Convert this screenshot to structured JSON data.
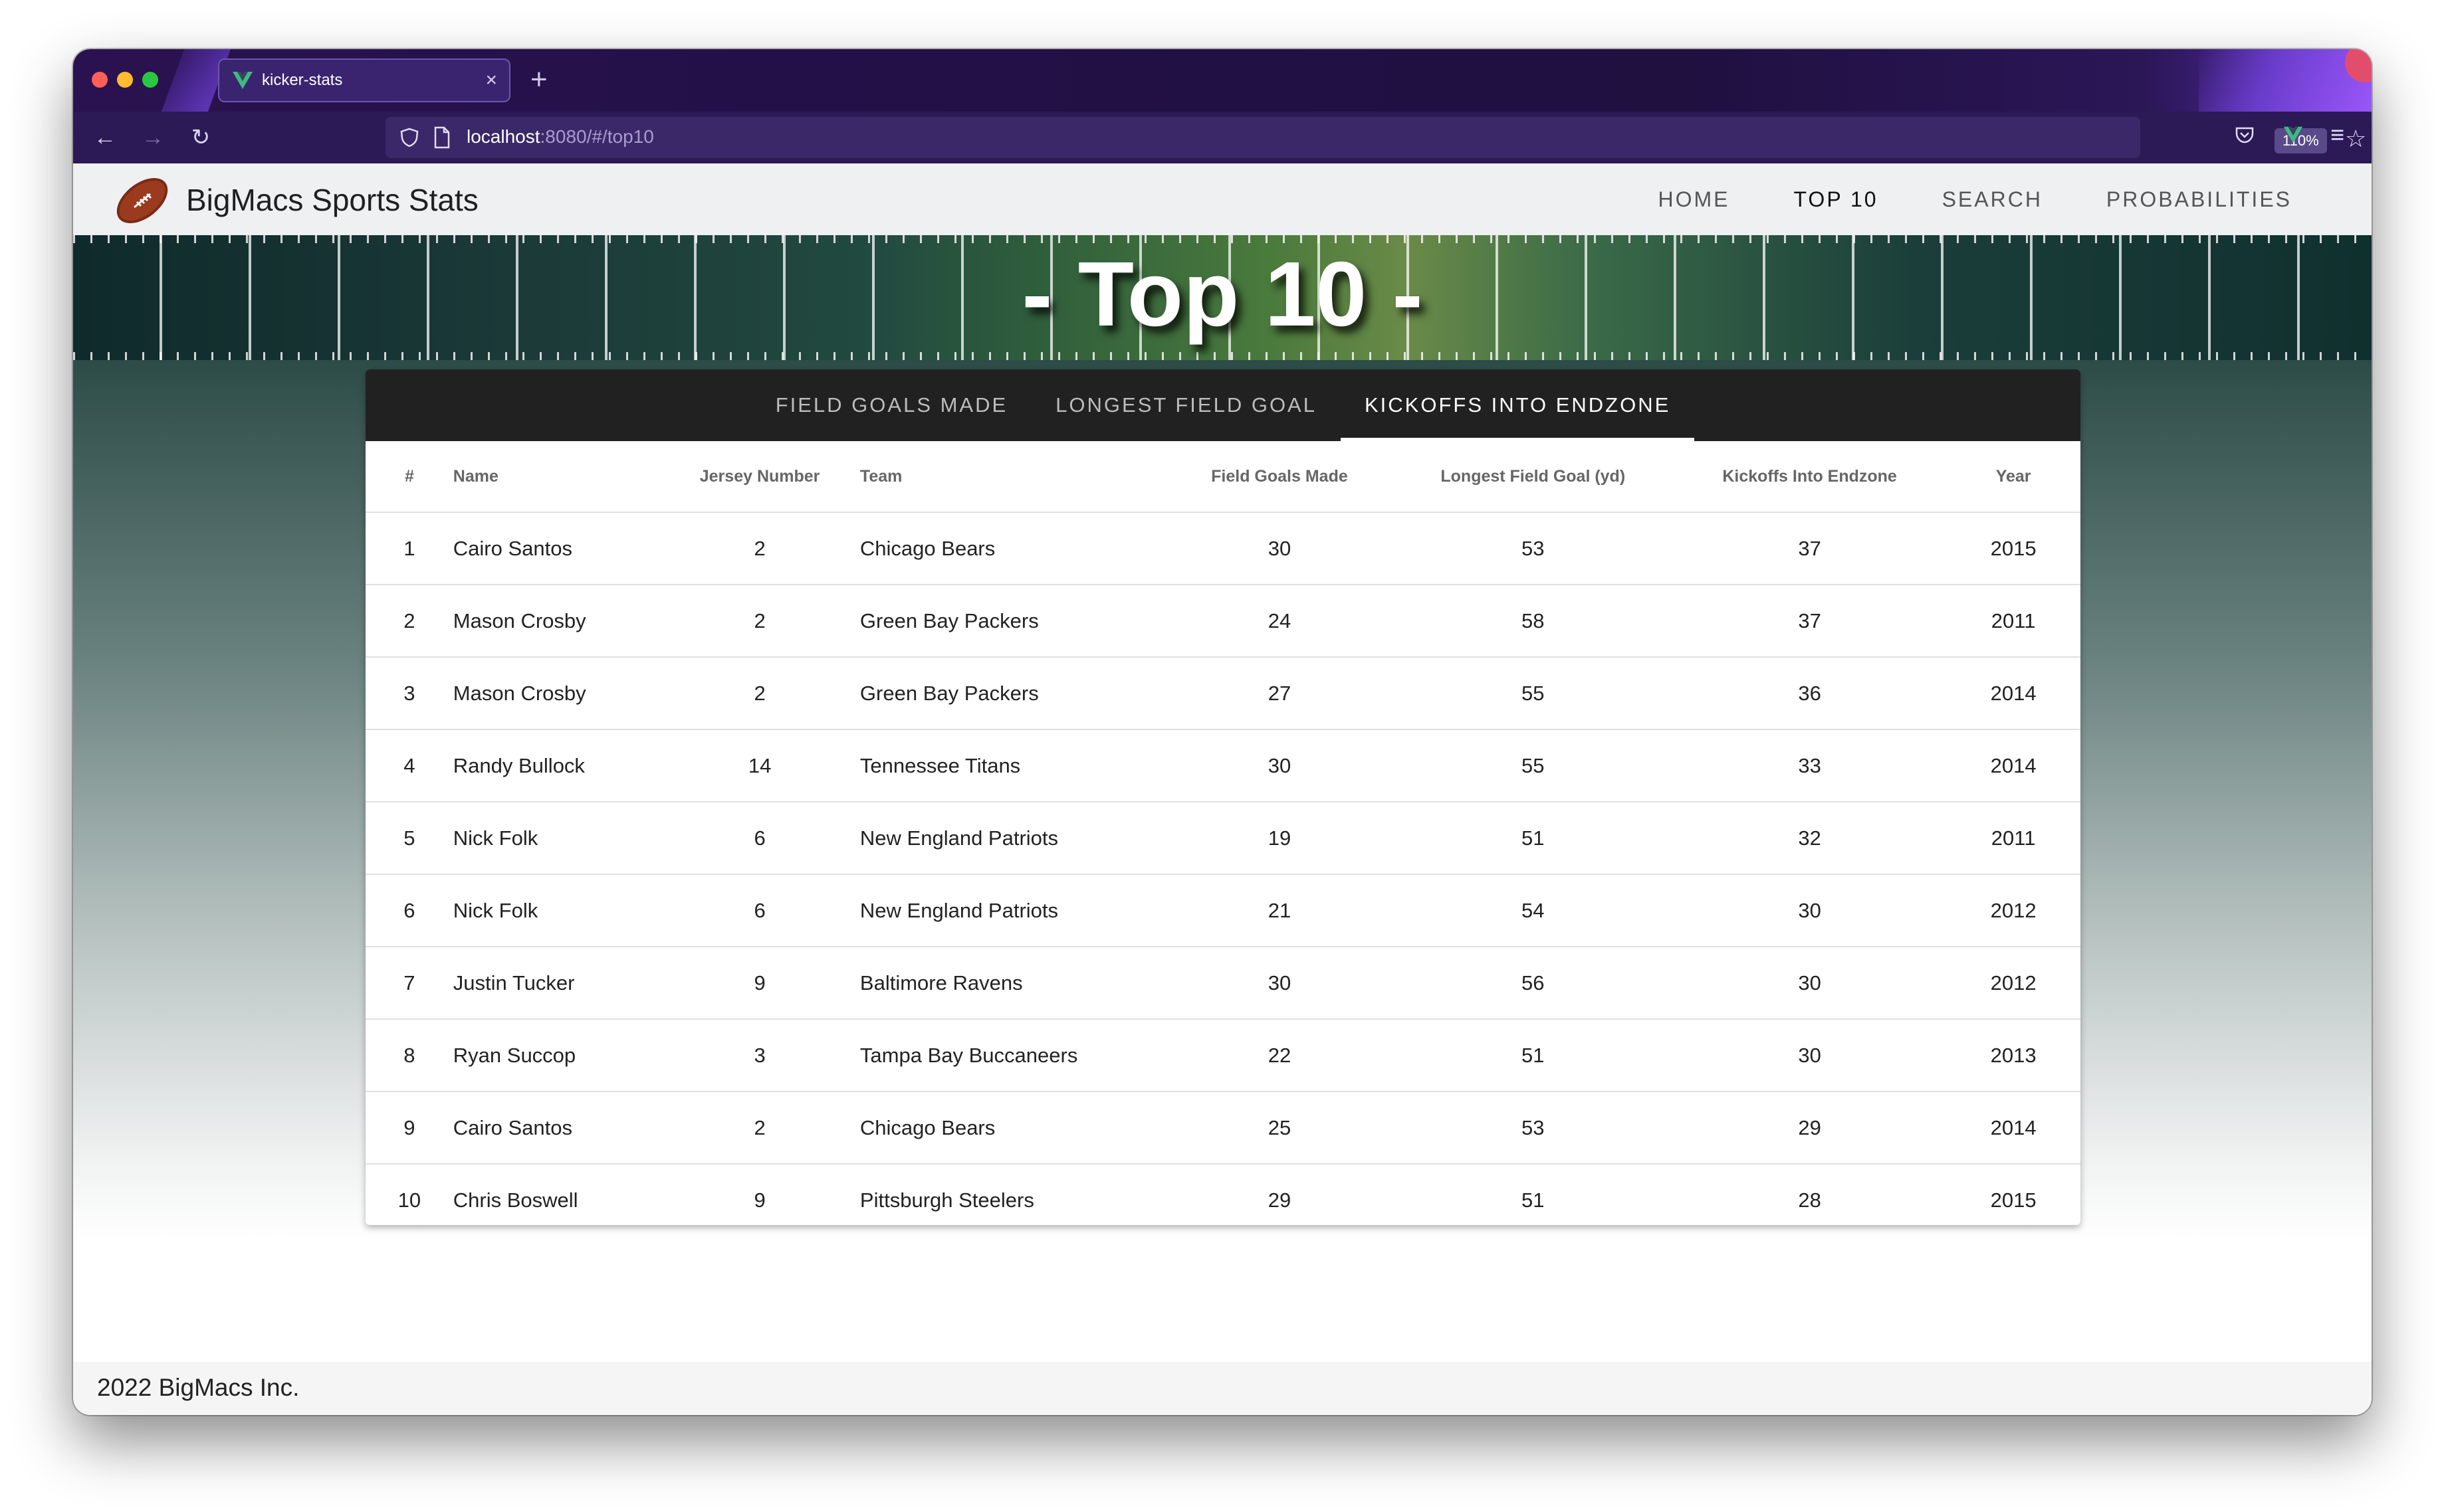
{
  "browser": {
    "tab_title": "kicker-stats",
    "tab_close": "×",
    "new_tab": "+",
    "url_host": "localhost",
    "url_rest": ":8080/#/top10",
    "zoom": "110%"
  },
  "app": {
    "brand": "BigMacs Sports Stats",
    "nav": [
      {
        "label": "HOME"
      },
      {
        "label": "TOP 10"
      },
      {
        "label": "SEARCH"
      },
      {
        "label": "PROBABILITIES"
      }
    ],
    "active_nav": "TOP 10"
  },
  "banner": {
    "title": "- Top 10 -"
  },
  "stat_tabs": [
    {
      "label": "FIELD GOALS MADE"
    },
    {
      "label": "LONGEST FIELD GOAL"
    },
    {
      "label": "KICKOFFS INTO ENDZONE"
    }
  ],
  "active_stat_tab": "KICKOFFS INTO ENDZONE",
  "table": {
    "headers": [
      "#",
      "Name",
      "Jersey Number",
      "Team",
      "Field Goals Made",
      "Longest Field Goal (yd)",
      "Kickoffs Into Endzone",
      "Year"
    ],
    "rows": [
      [
        "1",
        "Cairo Santos",
        "2",
        "Chicago Bears",
        "30",
        "53",
        "37",
        "2015"
      ],
      [
        "2",
        "Mason Crosby",
        "2",
        "Green Bay Packers",
        "24",
        "58",
        "37",
        "2011"
      ],
      [
        "3",
        "Mason Crosby",
        "2",
        "Green Bay Packers",
        "27",
        "55",
        "36",
        "2014"
      ],
      [
        "4",
        "Randy Bullock",
        "14",
        "Tennessee Titans",
        "30",
        "55",
        "33",
        "2014"
      ],
      [
        "5",
        "Nick Folk",
        "6",
        "New England Patriots",
        "19",
        "51",
        "32",
        "2011"
      ],
      [
        "6",
        "Nick Folk",
        "6",
        "New England Patriots",
        "21",
        "54",
        "30",
        "2012"
      ],
      [
        "7",
        "Justin Tucker",
        "9",
        "Baltimore Ravens",
        "30",
        "56",
        "30",
        "2012"
      ],
      [
        "8",
        "Ryan Succop",
        "3",
        "Tampa Bay Buccaneers",
        "22",
        "51",
        "30",
        "2013"
      ],
      [
        "9",
        "Cairo Santos",
        "2",
        "Chicago Bears",
        "25",
        "53",
        "29",
        "2014"
      ],
      [
        "10",
        "Chris Boswell",
        "9",
        "Pittsburgh Steelers",
        "29",
        "51",
        "28",
        "2015"
      ]
    ]
  },
  "footer": {
    "text": "2022 BigMacs Inc."
  },
  "colors": {
    "accent_vue_green": "#41b883",
    "browser_chrome": "#2b1a55",
    "tabs_bar": "#212121"
  },
  "icons": {
    "back": "arrow-left-icon",
    "forward": "arrow-right-icon",
    "reload": "reload-icon",
    "shield": "shield-icon",
    "page": "page-icon",
    "bookmark": "star-icon",
    "pocket": "pocket-icon",
    "extension": "vue-icon",
    "menu": "hamburger-menu-icon",
    "logo": "football-icon"
  }
}
